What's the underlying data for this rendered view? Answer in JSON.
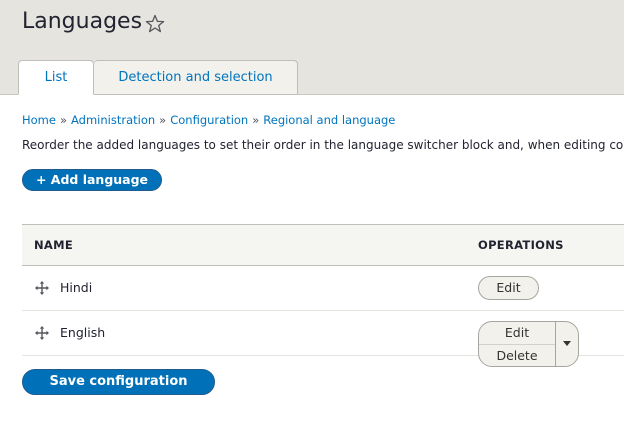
{
  "page": {
    "title": "Languages"
  },
  "tabs": [
    {
      "label": "List",
      "active": true
    },
    {
      "label": "Detection and selection",
      "active": false
    }
  ],
  "breadcrumb": {
    "items": [
      "Home",
      "Administration",
      "Configuration",
      "Regional and language"
    ],
    "separator": "»"
  },
  "description": "Reorder the added languages to set their order in the language switcher block and, when editing co",
  "actions": {
    "add_language_label": "+ Add language"
  },
  "table": {
    "headers": {
      "name": "NAME",
      "operations": "OPERATIONS"
    },
    "rows": [
      {
        "name": "Hindi",
        "operations": [
          "Edit"
        ]
      },
      {
        "name": "English",
        "operations": [
          "Edit",
          "Delete"
        ]
      }
    ]
  },
  "form": {
    "save_label": "Save configuration"
  },
  "colors": {
    "accent": "#0071b8",
    "header_bg": "#e6e4df",
    "link": "#0074bd"
  },
  "icons": {
    "favorite": "star-outline-icon",
    "drag": "drag-handle-icon",
    "dropdown": "caret-down-icon"
  }
}
